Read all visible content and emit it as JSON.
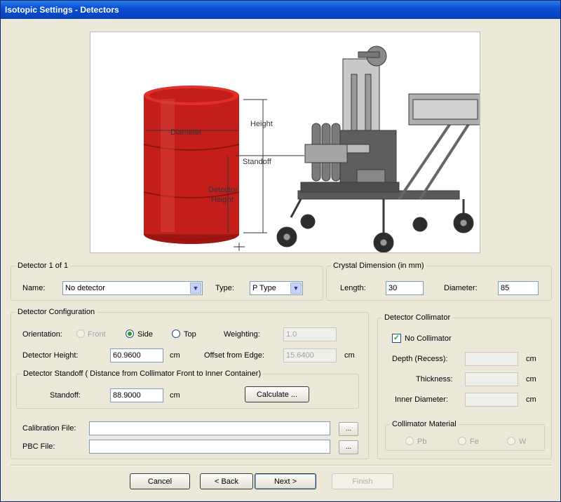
{
  "window": {
    "title": "Isotopic Settings - Detectors"
  },
  "illustration": {
    "labels": {
      "diameter": "Diameter",
      "height": "Height",
      "standoff": "Standoff",
      "detector_height_1": "Detector",
      "detector_height_2": "Height"
    },
    "colors": {
      "barrel": "#c41e1a",
      "frame": "#5a5a5a"
    }
  },
  "detector": {
    "legend": "Detector 1 of 1",
    "name_label": "Name:",
    "name_value": "No detector",
    "type_label": "Type:",
    "type_value": "P Type"
  },
  "crystal": {
    "legend": "Crystal Dimension (in mm)",
    "length_label": "Length:",
    "length_value": "30",
    "diameter_label": "Diameter:",
    "diameter_value": "85"
  },
  "config": {
    "legend": "Detector Configuration",
    "orientation_label": "Orientation:",
    "orientation_options": [
      "Front",
      "Side",
      "Top"
    ],
    "orientation_selected": "Side",
    "weighting_label": "Weighting:",
    "weighting_value": "1.0",
    "height_label": "Detector Height:",
    "height_value": "60.9600",
    "height_unit": "cm",
    "offset_label": "Offset from Edge:",
    "offset_value": "15.6400",
    "offset_unit": "cm",
    "standoff_legend": "Detector Standoff ( Distance from Collimator Front to Inner Container)",
    "standoff_label": "Standoff:",
    "standoff_value": "88.9000",
    "standoff_unit": "cm",
    "calculate_label": "Calculate ...",
    "calibration_label": "Calibration File:",
    "calibration_value": "",
    "pbc_label": "PBC File:",
    "pbc_value": "",
    "browse_label": "..."
  },
  "collimator": {
    "legend": "Detector Collimator",
    "no_collimator_label": "No Collimator",
    "no_collimator_checked": true,
    "depth_label": "Depth (Recess):",
    "thickness_label": "Thickness:",
    "inner_diameter_label": "Inner Diameter:",
    "unit": "cm",
    "material_legend": "Collimator Material",
    "materials": [
      "Pb",
      "Fe",
      "W"
    ],
    "material_selected": "Pb"
  },
  "footer": {
    "cancel": "Cancel",
    "back": "< Back",
    "next": "Next >",
    "finish": "Finish"
  }
}
